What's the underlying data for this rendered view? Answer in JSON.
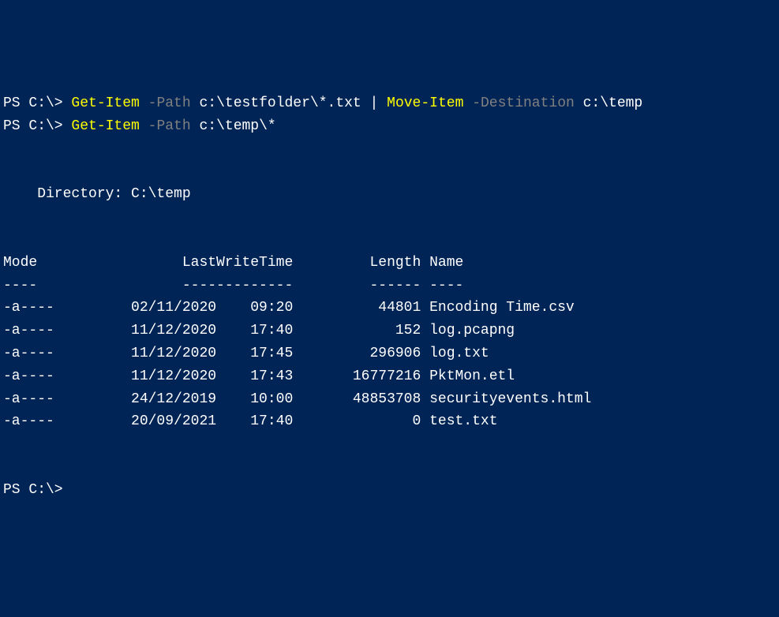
{
  "lines": {
    "line1": {
      "prompt": "PS C:\\> ",
      "cmd1": "Get-Item",
      "sp1": " ",
      "param1": "-Path",
      "sp2": " ",
      "arg1": "c:\\testfolder\\*.txt",
      "sp3": " ",
      "pipe": "|",
      "sp4": " ",
      "cmd2": "Move-Item",
      "sp5": " ",
      "param2": "-Destination",
      "sp6": " ",
      "arg2": "c:\\temp"
    },
    "line2": {
      "prompt": "PS C:\\> ",
      "cmd1": "Get-Item",
      "sp1": " ",
      "param1": "-Path",
      "sp2": " ",
      "arg1": "c:\\temp\\*"
    },
    "directory": "    Directory: C:\\temp",
    "headers": "Mode                 LastWriteTime         Length Name",
    "separator": "----                 -------------         ------ ----",
    "prompt_end": "PS C:\\>"
  },
  "files": [
    {
      "mode": "-a----",
      "date": "02/11/2020",
      "time": "09:20",
      "length": "44801",
      "name": "Encoding Time.csv"
    },
    {
      "mode": "-a----",
      "date": "11/12/2020",
      "time": "17:40",
      "length": "152",
      "name": "log.pcapng"
    },
    {
      "mode": "-a----",
      "date": "11/12/2020",
      "time": "17:45",
      "length": "296906",
      "name": "log.txt"
    },
    {
      "mode": "-a----",
      "date": "11/12/2020",
      "time": "17:43",
      "length": "16777216",
      "name": "PktMon.etl"
    },
    {
      "mode": "-a----",
      "date": "24/12/2019",
      "time": "10:00",
      "length": "48853708",
      "name": "securityevents.html"
    },
    {
      "mode": "-a----",
      "date": "20/09/2021",
      "time": "17:40",
      "length": "0",
      "name": "test.txt"
    }
  ]
}
